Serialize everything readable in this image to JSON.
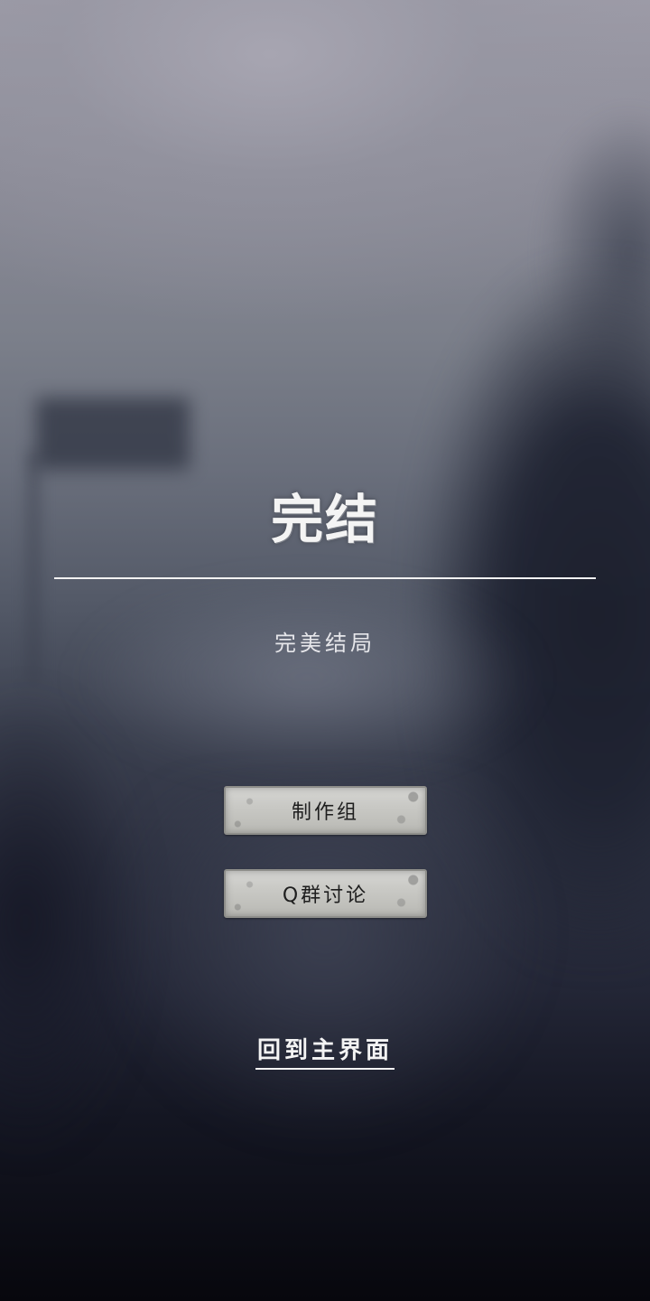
{
  "ending": {
    "title": "完结",
    "subtitle": "完美结局"
  },
  "buttons": {
    "credits_label": "制作组",
    "qgroup_label": "Q群讨论"
  },
  "navigation": {
    "home_label": "回到主界面"
  }
}
